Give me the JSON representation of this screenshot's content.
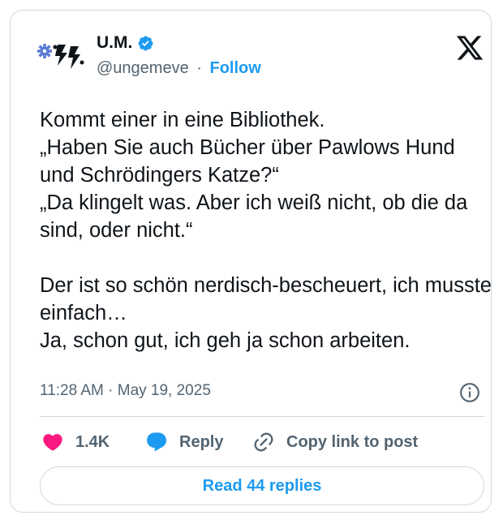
{
  "author": {
    "display_name": "U.M.",
    "handle": "@ungemeve",
    "separator": "·",
    "follow_label": "Follow",
    "verified": true,
    "avatar_icon": "lightning-gear-avatar-icon"
  },
  "post": {
    "text": "Kommt einer in eine Bibliothek.\n„Haben Sie auch Bücher über Pawlows Hund und Schrödingers Katze?“\n„Da klingelt was. Aber ich weiß nicht, ob die da sind, oder nicht.“\n\nDer ist so schön nerdisch-bescheuert, ich musste einfach…\nJa, schon gut, ich geh ja schon arbeiten.",
    "timestamp": "11:28 AM · May 19, 2025"
  },
  "actions": {
    "like_count": "1.4K",
    "reply_label": "Reply",
    "copy_label": "Copy link to post"
  },
  "footer": {
    "read_replies_label": "Read 44 replies"
  },
  "colors": {
    "accent": "#1d9bf0",
    "like": "#f91880",
    "text": "#0f1419",
    "muted": "#536471",
    "border": "#cfd9de"
  }
}
